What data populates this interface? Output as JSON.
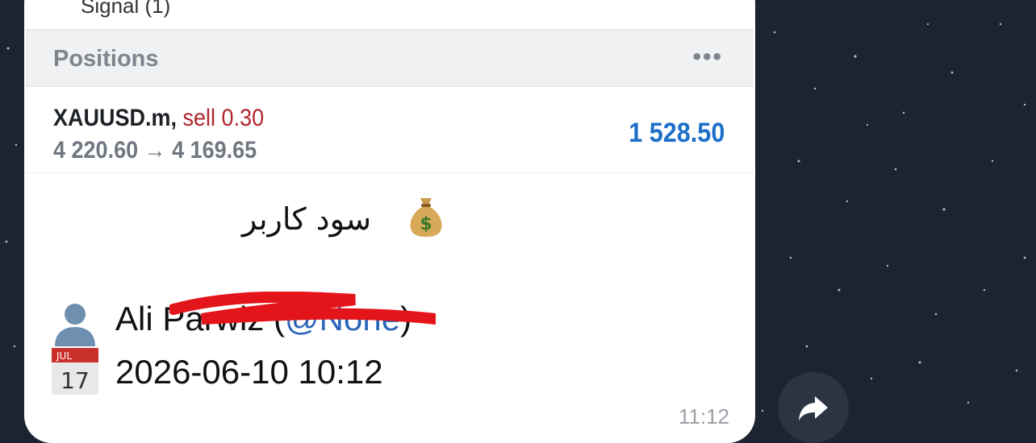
{
  "message": {
    "top_snippet": "Signal (1)",
    "positions": {
      "title": "Positions",
      "menu_icon": "more-dots-icon",
      "symbol": "XAUUSD.m,",
      "side": "sell 0.30",
      "prices": "4 220.60 → 4 169.65",
      "profit": "1 528.50"
    },
    "caption": "سود کاربر",
    "caption_icon": "money-bag-icon",
    "user": {
      "icon": "user-silhouette-icon",
      "name": "Ali Parwiz",
      "open_paren": " (",
      "handle": "@None",
      "close_paren": ")"
    },
    "date": {
      "icon": "calendar-icon",
      "calendar_month": "JUL",
      "calendar_day": "17",
      "value": "2026-06-10 10:12"
    },
    "time": "11:12"
  },
  "colors": {
    "profit": "#1d6fc9",
    "sell": "#b0262d",
    "handle": "#2a66b8",
    "background": "#1b2430"
  },
  "forward_button": {
    "icon": "forward-arrow-icon"
  }
}
